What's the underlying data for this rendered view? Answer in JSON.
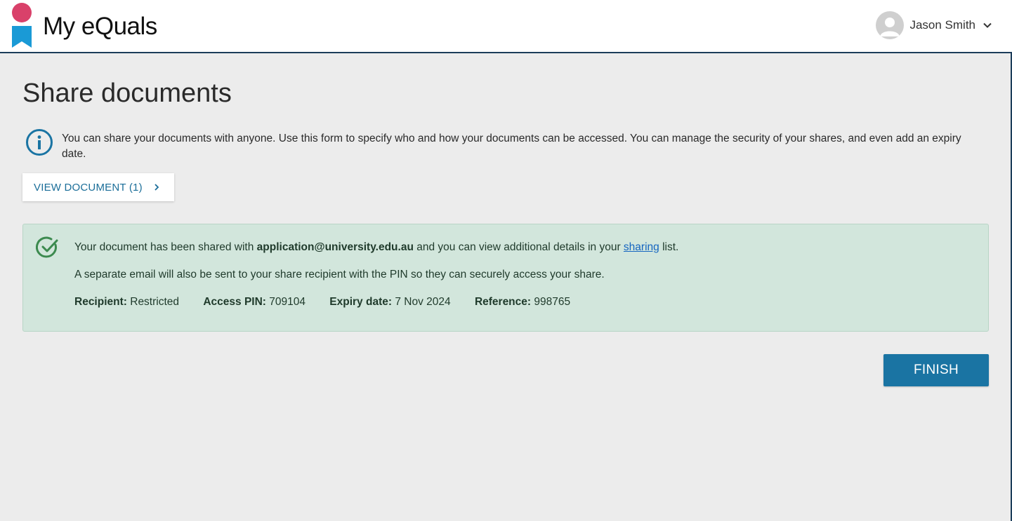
{
  "header": {
    "logo_text": "My eQuals",
    "user_name": "Jason Smith",
    "avatar_icon": "user-avatar-icon",
    "dropdown_icon": "chevron-down-icon"
  },
  "page": {
    "title": "Share documents",
    "info_icon": "info-icon",
    "info_text": "You can share your documents with anyone. Use this form to specify who and how your documents can be accessed. You can manage the security of your shares, and even add an expiry date."
  },
  "view_document": {
    "label": "VIEW DOCUMENT (1)",
    "icon": "chevron-right-icon"
  },
  "success": {
    "icon": "check-circle-icon",
    "line1_prefix": "Your document has been shared with ",
    "email": "application@university.edu.au",
    "line1_middle": " and you can view additional details in your ",
    "link_text": "sharing",
    "line1_suffix": " list.",
    "line2": "A separate email will also be sent to your share recipient with the PIN so they can securely access your share.",
    "recipient_label": "Recipient:",
    "recipient_value": " Restricted",
    "pin_label": "Access PIN:",
    "pin_value": " 709104",
    "expiry_label": "Expiry date:",
    "expiry_value": " 7 Nov 2024",
    "reference_label": "Reference:",
    "reference_value": " 998765"
  },
  "actions": {
    "finish_label": "FINISH"
  },
  "colors": {
    "brand_pink": "#d9416a",
    "brand_blue": "#1a9ad6",
    "accent": "#1a74a3",
    "success_bg": "#d2e6dc",
    "success_icon": "#3c8a4f",
    "background": "#ececec"
  }
}
